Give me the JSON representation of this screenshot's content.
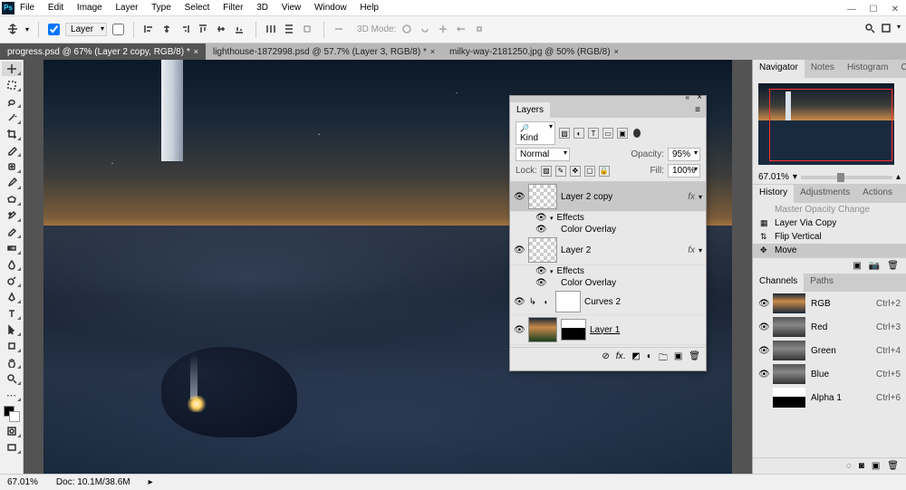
{
  "app": {
    "logo": "Ps"
  },
  "menu": [
    "File",
    "Edit",
    "Image",
    "Layer",
    "Type",
    "Select",
    "Filter",
    "3D",
    "View",
    "Window",
    "Help"
  ],
  "options": {
    "layer_dd": "Layer",
    "show_transform": true,
    "mode_label": "3D Mode:"
  },
  "tabs": [
    {
      "label": "progress.psd @ 67% (Layer 2 copy, RGB/8) *",
      "active": true
    },
    {
      "label": "lighthouse-1872998.psd @ 57.7% (Layer 3, RGB/8) *",
      "active": false
    },
    {
      "label": "milky-way-2181250.jpg @ 50% (RGB/8)",
      "active": false
    }
  ],
  "tools": [
    "move",
    "rect-marquee",
    "lasso",
    "magic-wand",
    "crop",
    "eyedropper",
    "spot-heal",
    "brush",
    "clone-stamp",
    "history-brush",
    "eraser",
    "gradient",
    "blur",
    "dodge",
    "pen",
    "type",
    "path-select",
    "rectangle",
    "hand",
    "zoom",
    "edit-toolbar",
    "swap-colors",
    "fg-bg",
    "quick-mask",
    "screen-mode"
  ],
  "layers_panel": {
    "title": "Layers",
    "kind_label": "Kind",
    "blend_mode": "Normal",
    "opacity_label": "Opacity:",
    "opacity_val": "95%",
    "lock_label": "Lock:",
    "fill_label": "Fill:",
    "fill_val": "100%",
    "items": [
      {
        "name": "Layer 2 copy",
        "fx": true,
        "selected": true,
        "effects": [
          "Effects",
          "Color Overlay"
        ]
      },
      {
        "name": "Layer 2",
        "fx": true,
        "effects": [
          "Effects",
          "Color Overlay"
        ]
      },
      {
        "name": "Curves 2",
        "adjustment": true
      },
      {
        "name": "Layer 1",
        "underline": true
      }
    ]
  },
  "navigator": {
    "tabs": [
      "Navigator",
      "Notes",
      "Histogram",
      "Color"
    ],
    "zoom": "67.01%"
  },
  "history": {
    "tabs": [
      "History",
      "Adjustments",
      "Actions"
    ],
    "items": [
      {
        "label": "Master Opacity Change",
        "faded": true
      },
      {
        "label": "Layer Via Copy"
      },
      {
        "label": "Flip Vertical"
      },
      {
        "label": "Move",
        "selected": true
      }
    ]
  },
  "channels": {
    "tabs": [
      "Channels",
      "Paths"
    ],
    "items": [
      {
        "name": "RGB",
        "key": "Ctrl+2"
      },
      {
        "name": "Red",
        "key": "Ctrl+3"
      },
      {
        "name": "Green",
        "key": "Ctrl+4"
      },
      {
        "name": "Blue",
        "key": "Ctrl+5"
      },
      {
        "name": "Alpha 1",
        "key": "Ctrl+6"
      }
    ]
  },
  "status": {
    "zoom": "67.01%",
    "doc": "Doc: 10.1M/38.6M"
  }
}
